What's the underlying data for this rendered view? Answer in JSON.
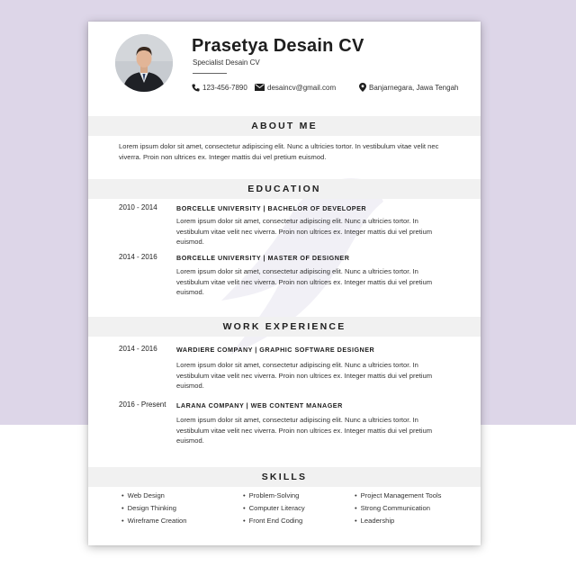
{
  "header": {
    "name": "Prasetya Desain CV",
    "role": "Specialist Desain CV",
    "phone": "123-456-7890",
    "email": "desaincv@gmail.com",
    "location": "Banjarnegara, Jawa Tengah"
  },
  "about": {
    "title": "ABOUT ME",
    "text": "Lorem ipsum dolor sit amet, consectetur adipiscing elit. Nunc a ultricies tortor. In vestibulum vitae velit nec viverra. Proin non ultrices ex. Integer mattis dui vel pretium euismod."
  },
  "education": {
    "title": "EDUCATION",
    "entries": [
      {
        "dates": "2010 - 2014",
        "heading": "BORCELLE UNIVERSITY | BACHELOR OF DEVELOPER",
        "text": "Lorem ipsum dolor sit amet, consectetur adipiscing elit. Nunc a ultricies tortor. In vestibulum vitae velit nec viverra. Proin non ultrices ex. Integer mattis dui vel pretium euismod."
      },
      {
        "dates": "2014 - 2016",
        "heading": "BORCELLE  UNIVERSITY | MASTER OF DESIGNER",
        "text": "Lorem ipsum dolor sit amet, consectetur adipiscing elit. Nunc a ultricies tortor. In vestibulum vitae velit nec viverra. Proin non ultrices ex. Integer mattis dui vel pretium euismod."
      }
    ]
  },
  "work": {
    "title": "WORK EXPERIENCE",
    "entries": [
      {
        "dates": "2014 - 2016",
        "heading": "WARDIERE COMPANY | GRAPHIC SOFTWARE DESIGNER",
        "text": "Lorem ipsum dolor sit amet, consectetur adipiscing elit. Nunc a ultricies tortor. In vestibulum vitae velit nec viverra. Proin non ultrices ex. Integer mattis dui vel pretium euismod."
      },
      {
        "dates": "2016 - Present",
        "heading": "LARANA COMPANY | WEB CONTENT MANAGER",
        "text": "Lorem ipsum dolor sit amet, consectetur adipiscing elit. Nunc a ultricies tortor. In vestibulum vitae velit nec viverra. Proin non ultrices ex. Integer mattis dui vel pretium euismod."
      }
    ]
  },
  "skills": {
    "title": "SKILLS",
    "items": [
      "Web Design",
      "Problem-Solving",
      "Project Management Tools",
      "Design Thinking",
      "Computer Literacy",
      "Strong Communication",
      "Wireframe Creation",
      "Front End Coding",
      "Leadership"
    ]
  },
  "colors": {
    "background_top": "#ddd6e8",
    "section_bar": "#f1f1f1",
    "text_dark": "#1e1e1e"
  },
  "icons": {
    "phone": "phone-icon",
    "email": "envelope-icon",
    "location": "map-pin-icon"
  }
}
